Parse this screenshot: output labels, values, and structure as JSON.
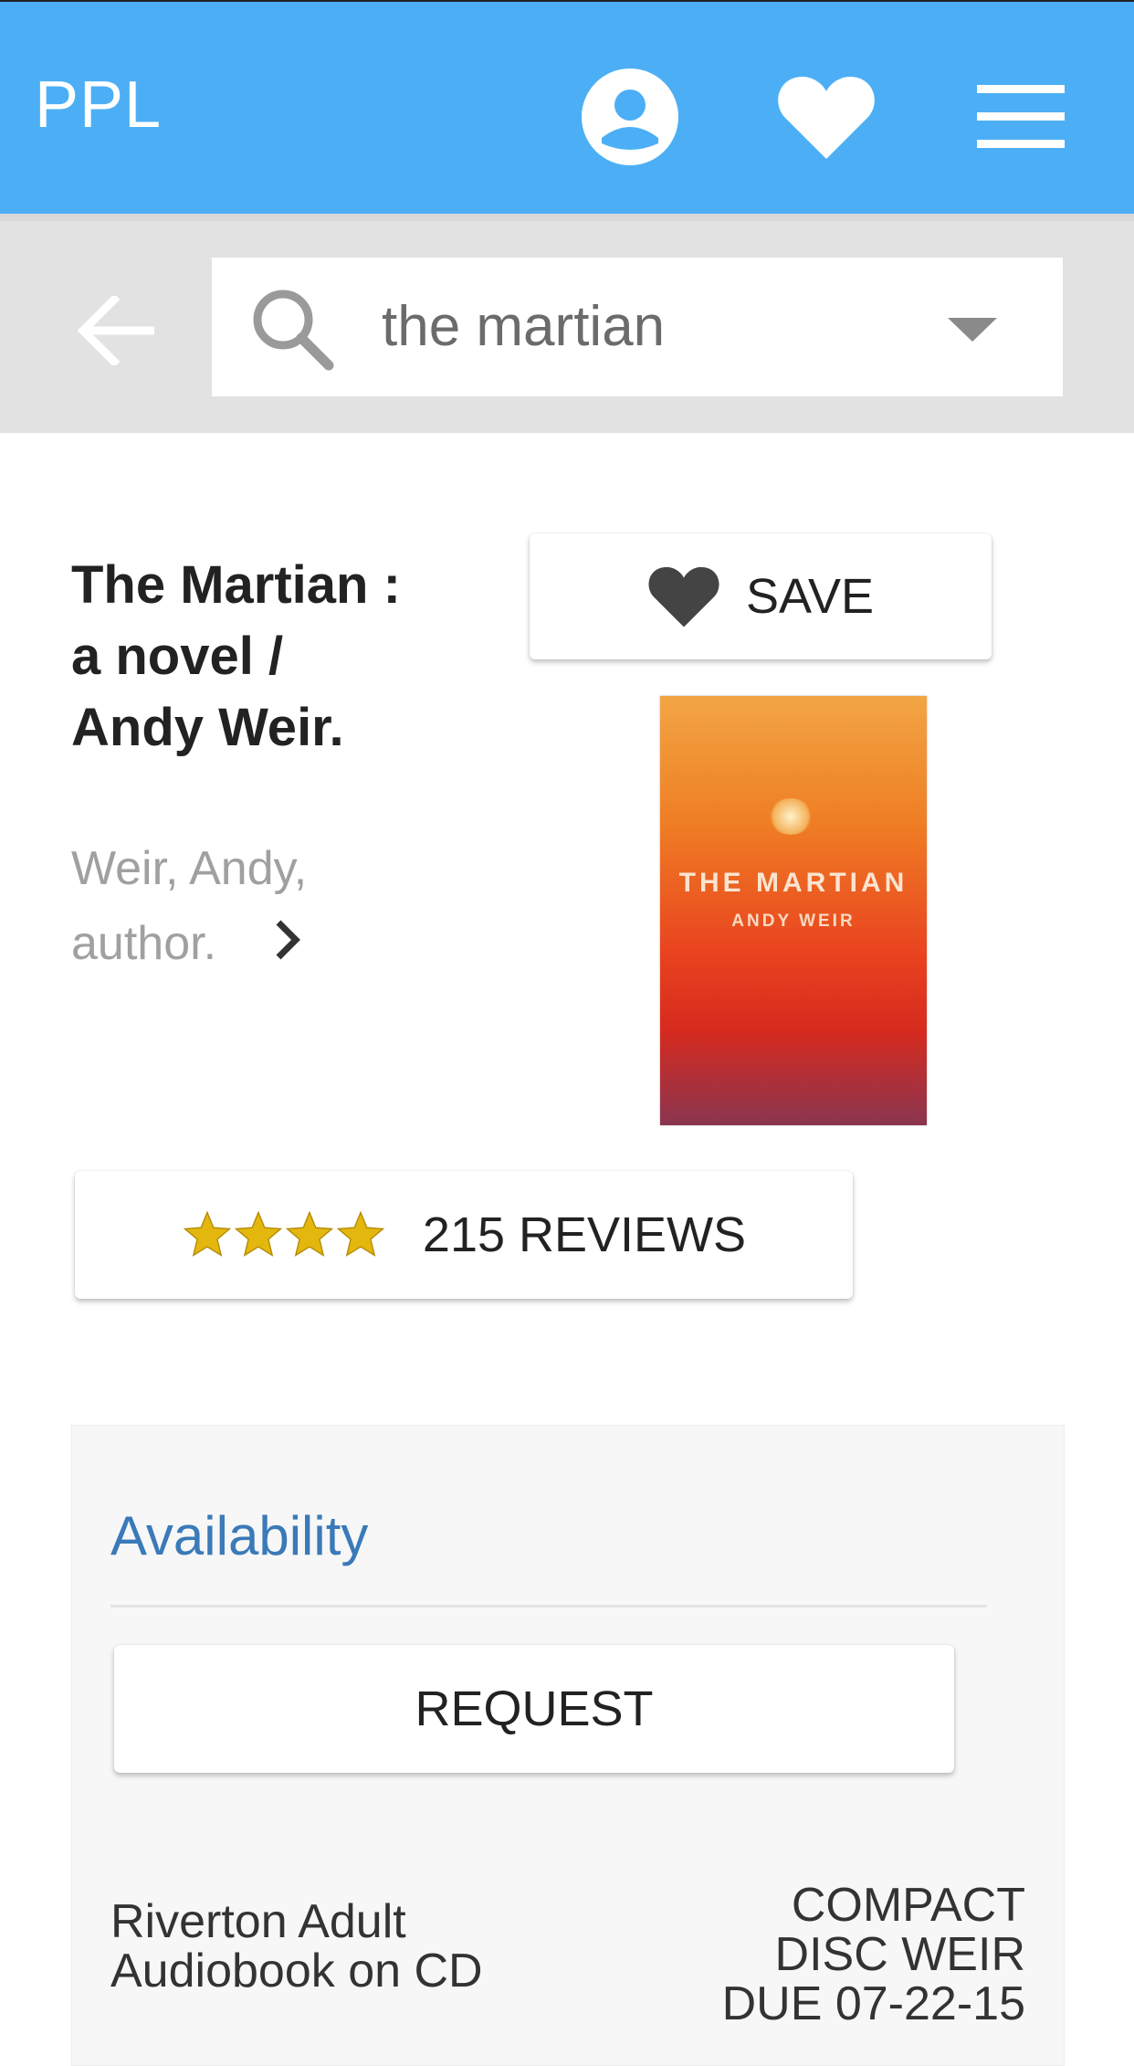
{
  "header": {
    "logo": "PPL",
    "icons": [
      "account-icon",
      "heart-icon",
      "menu-icon"
    ]
  },
  "search": {
    "query": "the martian",
    "back_icon": "arrow-left-icon"
  },
  "item": {
    "title_line1": "The Martian :",
    "title_line2": "a novel /",
    "title_line3": "Andy Weir.",
    "author_line1": "Weir, Andy,",
    "author_line2": "author.",
    "save_label": "SAVE",
    "cover_title": "THE MARTIAN",
    "cover_author": "ANDY WEIR",
    "rating_stars": 4,
    "reviews_label": "215 REVIEWS"
  },
  "availability": {
    "heading": "Availability",
    "request_label": "REQUEST",
    "location_line1": "Riverton Adult",
    "location_line2": "Audiobook on CD",
    "call_line1": "COMPACT",
    "call_line2": "DISC WEIR",
    "call_line3": "DUE 07-22-15"
  },
  "colors": {
    "header_bg": "#4caff5",
    "star": "#e3b70e",
    "availability_heading": "#3a7ab8"
  }
}
